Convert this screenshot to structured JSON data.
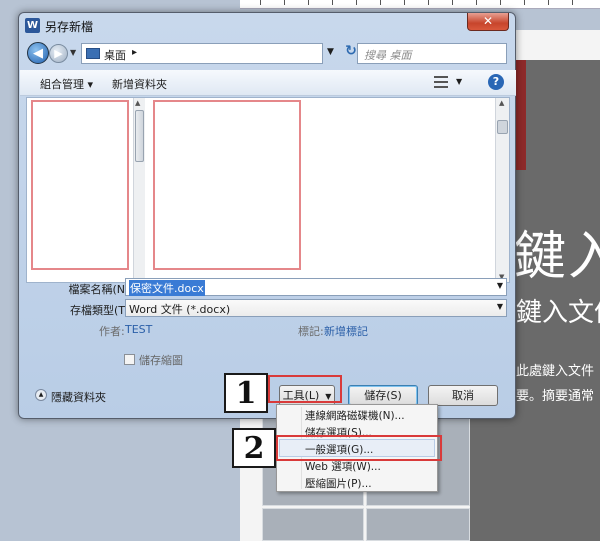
{
  "dialog": {
    "title": "另存新檔",
    "close": "✕",
    "app_icon": "W"
  },
  "address": {
    "location": "桌面",
    "separator": "▸",
    "search_placeholder": "搜尋 桌面"
  },
  "toolbar": {
    "organize": "組合管理 ▾",
    "new_folder": "新增資料夾",
    "help": "?"
  },
  "form": {
    "filename_label": "檔案名稱(N):",
    "filename_value": "保密文件.docx",
    "filetype_label": "存檔類型(T):",
    "filetype_value": "Word 文件 (*.docx)",
    "author_label": "作者:",
    "author_value": "TEST",
    "tags_label": "標記:",
    "tags_value": "新增標記",
    "thumbnail_label": "儲存縮圖"
  },
  "footer": {
    "hide_folders": "隱藏資料夾",
    "tools": "工具(L)",
    "save": "儲存(S)",
    "cancel": "取消"
  },
  "tools_menu": {
    "items": [
      "連線網路磁碟機(N)...",
      "儲存選項(S)...",
      "一般選項(G)...",
      "Web 選項(W)...",
      "壓縮圖片(P)..."
    ]
  },
  "callouts": {
    "one": "1",
    "two": "2"
  },
  "background": {
    "heading": "鍵入",
    "subheading": "鍵入文件",
    "line1": "此處鍵入文件",
    "line2": "要。摘要通常"
  },
  "colors": {
    "annotation_red": "#d93a3a",
    "selection_blue": "#3a7bd5"
  }
}
